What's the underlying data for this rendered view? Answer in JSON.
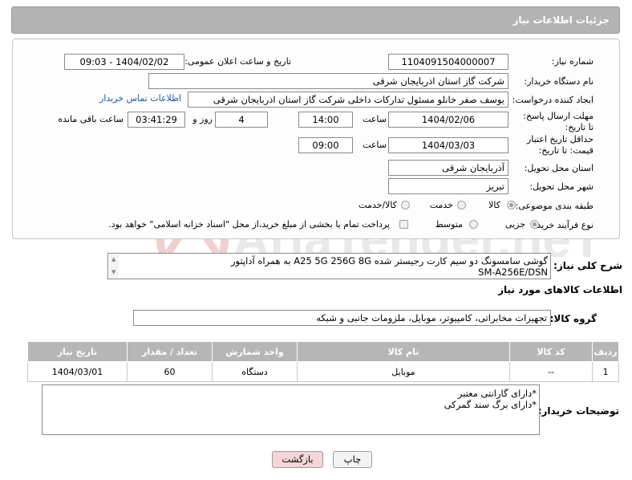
{
  "header": {
    "title": "جزئیات اطلاعات نیاز"
  },
  "form": {
    "need_number_label": "شماره نیاز:",
    "need_number": "1104091504000007",
    "announce_label": "تاریخ و ساعت اعلان عمومی:",
    "announce_value": "1404/02/02 - 09:03",
    "buyer_org_label": "نام دستگاه خریدار:",
    "buyer_org": "شرکت گاز استان اذربایجان شرقی",
    "requester_label": "ایجاد کننده درخواست:",
    "requester": "یوسف صفر خانلو  مسئول تدارکات داخلی  شرکت گاز استان اذربایجان شرقی",
    "contact_link": "اطلاعات تماس خریدار",
    "reply_deadline_label": "مهلت ارسال پاسخ: تا تاریخ:",
    "reply_date": "1404/02/06",
    "time_label": "ساعت",
    "reply_time": "14:00",
    "days_value": "4",
    "days_label": "روز و",
    "remaining_time": "03:41:29",
    "remaining_label": "ساعت باقی مانده",
    "price_deadline_label": "حداقل تاریخ اعتبار قیمت: تا تاریخ:",
    "price_date": "1404/03/03",
    "price_time": "09:00",
    "province_label": "استان محل تحویل:",
    "province": "آذربایجان شرقی",
    "city_label": "شهر محل تحویل:",
    "city": "تبریز",
    "category_label": "طبقه بندی موضوعی:",
    "category_options": [
      "کالا",
      "خدمت",
      "کالا/خدمت"
    ],
    "process_label": "نوع فرآیند خرید :",
    "process_options": [
      "جزیی",
      "متوسط"
    ],
    "payment_note": "پرداخت تمام یا بخشی از مبلغ خرید،از محل \"اسناد خزانه اسلامی\" خواهد بود."
  },
  "description": {
    "label": "شرح کلی نیاز:",
    "line1": "گوشی سامسونگ دو سیم کارت رجیستر شده A25 5G 256G 8G  به همراه آداپتور",
    "line2": "SM-A256E/DSN"
  },
  "goods": {
    "title": "اطلاعات کالاهای مورد نیاز",
    "group_label": "گروه کالا:",
    "group_value": "تجهیزات مخابراتی، کامپیوتر، موبایل، ملزومات جانبی و شبکه",
    "columns": [
      "ردیف",
      "کد کالا",
      "نام کالا",
      "واحد شمارش",
      "تعداد / مقدار",
      "تاریخ نیاز"
    ],
    "rows": [
      {
        "index": "1",
        "code": "--",
        "name": "موبایل",
        "unit": "دستگاه",
        "qty": "60",
        "date": "1404/03/01"
      }
    ]
  },
  "buyer_notes": {
    "label": "توضیحات خریدار:",
    "line1": "*دارای گارانتی معتبر",
    "line2": "*دارای برگ سند گمرکی"
  },
  "buttons": {
    "print": "چاپ",
    "back": "بازگشت"
  },
  "watermark": {
    "text": "AriaTender.neT"
  },
  "colors": {
    "header_bg": "#b3b3b3",
    "link": "#1a56b5",
    "back_button": "#f4d6d6",
    "watermark": "#c62828"
  }
}
